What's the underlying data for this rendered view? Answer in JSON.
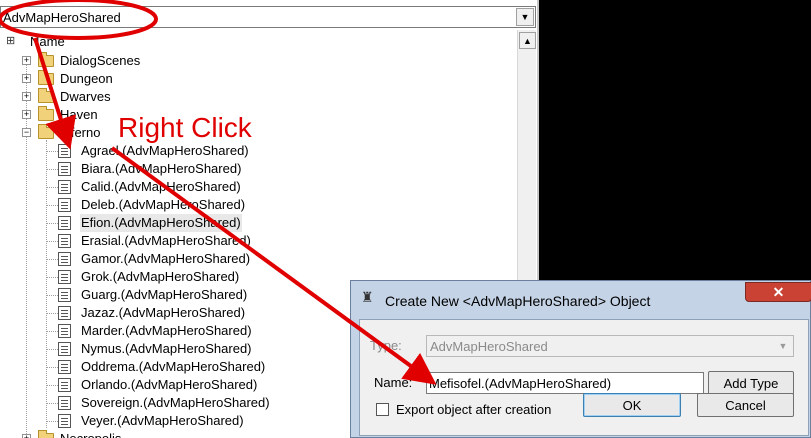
{
  "combo": {
    "value": "AdvMapHeroShared"
  },
  "tree": {
    "header": "Name",
    "folders": [
      {
        "label": "DialogScenes",
        "expander": "+"
      },
      {
        "label": "Dungeon",
        "expander": "+"
      },
      {
        "label": "Dwarves",
        "expander": "+"
      },
      {
        "label": "Haven",
        "expander": "+"
      },
      {
        "label": "Inferno",
        "expander": "−"
      }
    ],
    "items": [
      "Agrael.(AdvMapHeroShared)",
      "Biara.(AdvMapHeroShared)",
      "Calid.(AdvMapHeroShared)",
      "Deleb.(AdvMapHeroShared)",
      "Efion.(AdvMapHeroShared)",
      "Erasial.(AdvMapHeroShared)",
      "Gamor.(AdvMapHeroShared)",
      "Grok.(AdvMapHeroShared)",
      "Guarg.(AdvMapHeroShared)",
      "Jazaz.(AdvMapHeroShared)",
      "Marder.(AdvMapHeroShared)",
      "Nymus.(AdvMapHeroShared)",
      "Oddrema.(AdvMapHeroShared)",
      "Orlando.(AdvMapHeroShared)",
      "Sovereign.(AdvMapHeroShared)",
      "Veyer.(AdvMapHeroShared)"
    ],
    "selected_item": "Efion.(AdvMapHeroShared)",
    "partial_folder": "Necropolis"
  },
  "dialog": {
    "title": "Create New <AdvMapHeroShared> Object",
    "close_label": "✕",
    "type_label": "Type:",
    "type_value": "AdvMapHeroShared",
    "name_label": "Name:",
    "name_value": "Mefisofel.(AdvMapHeroShared)",
    "add_type_label": "Add Type",
    "export_label": "Export object after creation",
    "export_checked": false,
    "ok_label": "OK",
    "cancel_label": "Cancel"
  },
  "annotation": {
    "text": "Right Click",
    "color": "#e00000"
  },
  "icons": {
    "combo_dropdown": "chevron-down-icon",
    "scroll_up": "chevron-up-icon",
    "tree_header": "tree-header-icon",
    "folder": "folder-icon",
    "file": "file-icon",
    "dialog": "app-icon"
  }
}
